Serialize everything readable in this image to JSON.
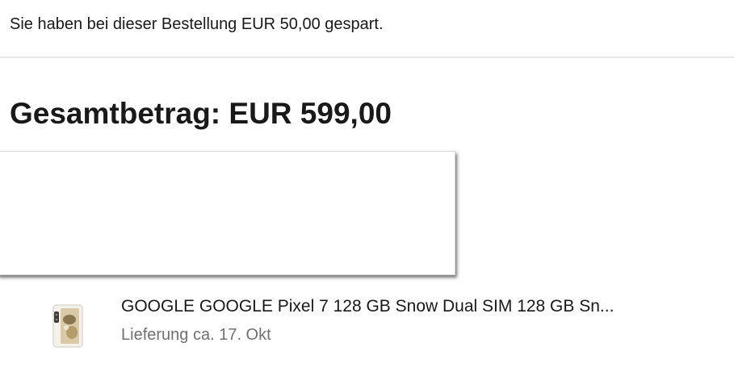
{
  "savings": {
    "text": "Sie haben bei dieser Bestellung EUR 50,00 gespart."
  },
  "total": {
    "label": "Gesamtbetrag: EUR 599,00"
  },
  "order_item": {
    "thumbnail_icon": "phone-product-image",
    "title": "GOOGLE GOOGLE Pixel 7 128 GB Snow Dual SIM 128 GB Sn...",
    "delivery": "Lieferung ca. 17. Okt"
  },
  "colors": {
    "text_primary": "#191919",
    "text_secondary": "#707070",
    "divider": "#e5e5e5"
  }
}
